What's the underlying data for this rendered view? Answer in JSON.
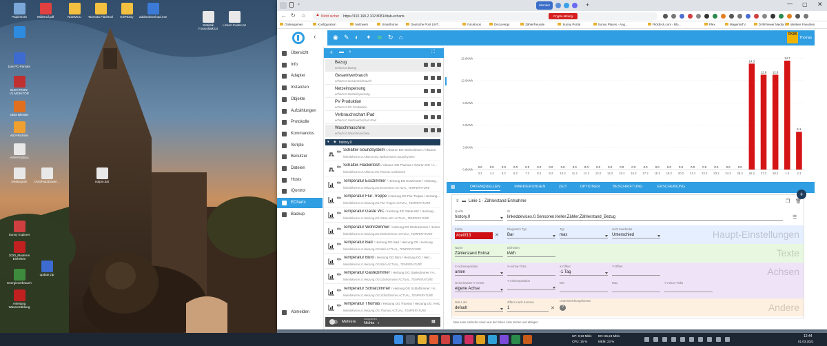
{
  "desktop": {
    "icons": [
      {
        "label": "Papierkorb",
        "color": "#7aa7d8"
      },
      {
        "label": "Widerruf.pdf",
        "color": "#e04040"
      },
      {
        "label": "NoteMCU",
        "color": "#f4c040"
      },
      {
        "label": "Tasmota Flashtool",
        "color": "#f4c040"
      },
      {
        "label": "ESPEasy",
        "color": "#f4c040"
      },
      {
        "label": "adobedownload.exe",
        "color": "#3b7ad6"
      },
      {
        "label": "Statistik Fotovoltaik.txt",
        "color": "#e8e8e8"
      },
      {
        "label": "Lizenz-Codes.txt",
        "color": "#e8e8e8"
      },
      {
        "label": "",
        "color": "#2d8be0"
      },
      {
        "label": "Das PC-Fenster",
        "color": "#3d6bd0"
      },
      {
        "label": "ELECTRON-V1.MONITOR",
        "color": "#c03030"
      },
      {
        "label": "OEM Blender",
        "color": "#e07020"
      },
      {
        "label": "AIO-Rechner",
        "color": "#f0a030"
      },
      {
        "label": "AVM-FritzBox",
        "color": "#e8e8e8"
      },
      {
        "label": "DesktopOK",
        "color": "#e8e8e8"
      },
      {
        "label": "DVDFab2Downl...",
        "color": "#e8e8e8"
      },
      {
        "label": "notpm.bat",
        "color": "#e8e8e8"
      },
      {
        "label": "Sunny Explorer",
        "color": "#d04040"
      },
      {
        "label": "2020_Moderne Einheiten",
        "color": "#c02020"
      },
      {
        "label": "Energieverbrauch",
        "color": "#3d8b3d"
      },
      {
        "label": "update.zip",
        "color": "#3d6bd0"
      },
      {
        "label": "Anleitung Wasserzählung",
        "color": "#c02020"
      }
    ]
  },
  "browser": {
    "tab_label": "iobroker",
    "security": "Nicht sicher",
    "url": "https://192.168.2.102:8081/#tab-echarts",
    "badge": "Crypto-Mining",
    "bookmarks": [
      "Onlinegames",
      "Konfiguration",
      "Netzwerk",
      "Smarthome",
      "Deutsche Post | INT...",
      "Facebook",
      "Discovergy",
      "Zählerfreunde",
      "Sunny Portal",
      "Sunny Places - Ang...",
      "Flickfeck.com - Blo...",
      "Plex",
      "MagentaTV",
      "DVBViewer Media S..."
    ],
    "bookmarks_more": "Weitere Favoriten"
  },
  "app": {
    "brand_top": "TKM",
    "brand_user": "Thomas",
    "nav": [
      {
        "label": "Übersicht",
        "icon": "overview-icon"
      },
      {
        "label": "Info",
        "icon": "info-icon"
      },
      {
        "label": "Adapter",
        "icon": "adapter-icon"
      },
      {
        "label": "Instanzen",
        "icon": "instances-icon"
      },
      {
        "label": "Objekte",
        "icon": "objects-icon"
      },
      {
        "label": "Aufzählungen",
        "icon": "enums-icon"
      },
      {
        "label": "Protokolle",
        "icon": "logs-icon"
      },
      {
        "label": "Kommandos",
        "icon": "commands-icon"
      },
      {
        "label": "Skripte",
        "icon": "scripts-icon"
      },
      {
        "label": "Benutzer",
        "icon": "users-icon"
      },
      {
        "label": "Dateien",
        "icon": "files-icon"
      },
      {
        "label": "Hosts",
        "icon": "hosts-icon"
      },
      {
        "label": "iQontrol",
        "icon": "iqontrol-icon"
      },
      {
        "label": "ECharts",
        "icon": "echarts-icon"
      },
      {
        "label": "Backup",
        "icon": "backup-icon"
      }
    ],
    "logout": "Abmelden",
    "charts": [
      {
        "title": "Bezug",
        "sub": "echarts.0.Bezug"
      },
      {
        "title": "Gesamtverbrauch",
        "sub": "echarts.0.Gesamtverbrauch"
      },
      {
        "title": "Netzeinspeisung",
        "sub": "echarts.0.Netzeinspeisung"
      },
      {
        "title": "PV Produktion",
        "sub": "echarts.0.PV Produktion"
      },
      {
        "title": "Verbrauchschart iPad",
        "sub": "echarts.0.Verbrauchschart iPad"
      },
      {
        "title": "Waschmaschine",
        "sub": "echarts.0.Waschmaschine"
      }
    ],
    "history_group": "history.0",
    "states": [
      {
        "title": "Schalter-Soundsystem",
        "loc": "/ Aktoren EG Wohnzimmer / Aktoren",
        "sub": "linkeddevices.0.Aktoren.EG.Wohnzimmer.Soundsystem",
        "icon": "switch"
      },
      {
        "title": "Schalter-Hackintosh",
        "loc": "/ Aktoren OG Thomas / Aktoren OG / A...",
        "sub": "linkeddevices.0.Aktoren.OG.Thomas.Hackintosh",
        "icon": "switch"
      },
      {
        "title": "Temperatur Esszimmer",
        "loc": "/ Heizung EG Esszimmer / Heizung...",
        "sub": "linkeddevices.0.Heizung.EG.Esszimmer.ACTUAL_TEMPERATURE",
        "icon": "chart"
      },
      {
        "title": "Temperatur Flur-Treppe",
        "loc": "/ Heizung EG Flur-Treppe / Heizung...",
        "sub": "linkeddevices.0.Heizung.EG.Flur-Treppe.ACTUAL_TEMPERATURE",
        "icon": "chart"
      },
      {
        "title": "Temperatur Gäste WC",
        "loc": "/ Heizung EG Gäste-WC / Heizung...",
        "sub": "linkeddevices.0.Heizung.EG.Gäste-WC.ACTUAL_TEMPERATURE",
        "icon": "chart"
      },
      {
        "title": "Temperatur Wohnzimmer",
        "loc": "/ Heizung EG Wohnzimmer / Heizung...",
        "sub": "linkeddevices.0.Heizung.EG.Wohnzimmer.ACTUAL_TEMPERATURE",
        "icon": "chart"
      },
      {
        "title": "Temperatur Bad",
        "loc": "/ Heizung OG Bad / Heizung OG / Heizung",
        "sub": "linkeddevices.0.Heizung.OG.Bad.ACTUAL_TEMPERATURE",
        "icon": "chart"
      },
      {
        "title": "Temperatur Büro",
        "loc": "/ Heizung OG Büro / Heizung OG / Heiz...",
        "sub": "linkeddevices.0.Heizung.OG.Büro.ACTUAL_TEMPERATURE",
        "icon": "chart"
      },
      {
        "title": "Temperatur Gästezimmer",
        "loc": "/ Heizung OG Gästezimmer / H...",
        "sub": "linkeddevices.0.Heizung.OG.Gästezimmer.ACTUAL_TEMPERATURE",
        "icon": "chart"
      },
      {
        "title": "Temperatur Schlafzimmer",
        "loc": "/ Heizung OG Schlafzimmer / H...",
        "sub": "linkeddevices.0.Heizung.OG.Schlafzimmer.ACTUAL_TEMPERATURE",
        "icon": "chart"
      },
      {
        "title": "Temperatur Thomas",
        "loc": "/ Heizung OG Thomas / Heizung OG / Heiz...",
        "sub": "linkeddevices.0.Heizung.OG.Thomas.ACTUAL_TEMPERATURE",
        "icon": "chart"
      }
    ],
    "footer": {
      "more_label": "Mehrere",
      "group_label": "Gruppieren",
      "group_value": "Nichts"
    },
    "tabs": [
      "DATENQUELLEN",
      "MARKIERUNGEN",
      "ZEIT",
      "OPTIONEN",
      "BESCHRIFTUNG",
      "ERSCHEINUNG"
    ],
    "line": {
      "title": "Linie 1 - Zählerstand Entnahme",
      "quelle_label": "Quelle",
      "quelle": "history.0",
      "id_label": "ID",
      "id": "linkeddevices.0.Sensoren.Keller.Zähler.Zählerstand_Bezug",
      "band1": "Haupt-Einstellungen",
      "farbe_label": "Farbe",
      "farbe": "#ce0f13",
      "diagrammtyp_label": "Diagramm Typ",
      "diagrammtyp": "Bar",
      "typ_label": "Typ",
      "typ": "max",
      "nicht_label": "nicht bearbeitet",
      "nicht": "Unterschied",
      "band2": "Texte",
      "name_label": "Name",
      "name": "Zählerstand Entnal",
      "einheiten_label": "Einheiten",
      "einheiten": "kWh",
      "band3": "Achsen",
      "xpos_label": "X-Achsenposition",
      "xpos": "unten",
      "xticks_label": "X-Achse-Ticks",
      "xoffset_label": "X-Offset",
      "xoffset": "-1 Tag",
      "yoffset_label": "Y-Offset",
      "gemeinsam_label": "Gemeinsame Y-Achse",
      "gemeinsam": "eigene Achse",
      "ypos_label": "Y-Achsenposition",
      "min_label": "Min",
      "max_label": "Max",
      "yticks_label": "Y-Achse-Ticks",
      "band4": "Andere",
      "null_label": "NULL als",
      "null": "default",
      "ziffern_label": "Ziffern nach Komma",
      "ziffern": "1",
      "unterstreichung_label": "Unterstreichungsformat",
      "footnote": "Man kann einfache Linien aus der linken Liste ziehen und ablegen."
    },
    "colors": {
      "accent": "#2f9ee2",
      "bar": "#d51515"
    }
  },
  "chart_data": {
    "type": "bar",
    "categories": [
      "3.2",
      "4.2",
      "5.2",
      "6.2",
      "7.2",
      "8.2",
      "9.2",
      "10.2",
      "11.2",
      "12.2",
      "13.2",
      "14.2",
      "15.2",
      "16.2",
      "17.2",
      "18.2",
      "19.2",
      "20.2",
      "21.2",
      "22.2",
      "23.2",
      "24.2",
      "25.2",
      "26.2",
      "27.2",
      "28.2",
      "1.3",
      "2.3"
    ],
    "values": [
      0,
      0,
      0,
      0,
      0,
      0,
      0,
      0,
      0,
      0,
      0,
      0,
      0,
      0,
      0,
      0,
      0,
      0,
      0,
      0,
      0,
      0,
      0,
      14.3,
      12.8,
      12.8,
      14.7,
      5.1
    ],
    "value_labels": [
      "0.0",
      "0.0",
      "0.0",
      "0.0",
      "0.0",
      "0.0",
      "0.0",
      "0.0",
      "0.0",
      "0.0",
      "0.0",
      "0.0",
      "0.0",
      "0.0",
      "0.0",
      "0.0",
      "0.0",
      "0.0",
      "0.0",
      "0.0",
      "0.0",
      "0.0",
      "0.0",
      "14.3",
      "12.8",
      "12.8",
      "14.7",
      "5.1"
    ],
    "ylim": [
      0,
      16
    ],
    "yticks": [
      0,
      3,
      6,
      9,
      12,
      15
    ],
    "ytick_labels": [
      "0.0kWh",
      "3.0kWh",
      "6.0kWh",
      "9.0kWh",
      "12.0kWh",
      "15.0kWh"
    ],
    "unit": "kWh",
    "grid": true
  },
  "taskbar": {
    "up": "UP: 0,93 Mb/s",
    "dn": "DN: 65,24 Mb/s",
    "cpu": "CPU: 15 %",
    "mem": "MEM: 23 %",
    "time": "12:44",
    "date": "01.03.2021"
  }
}
